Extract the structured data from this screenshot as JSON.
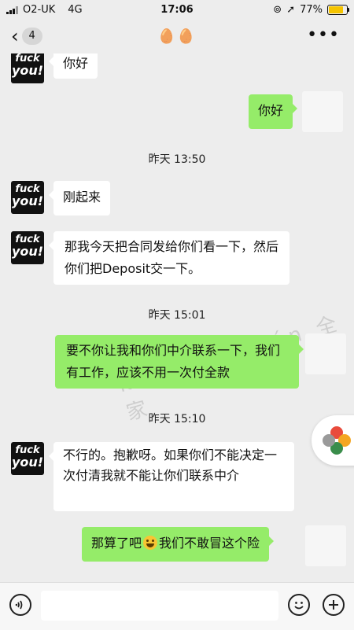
{
  "status_bar": {
    "carrier": "O2-UK",
    "network": "4G",
    "time": "17:06",
    "battery": "77%",
    "battery_level": 0.77
  },
  "nav": {
    "unread_count": "4",
    "title": "🥚🥚"
  },
  "messages": [
    {
      "side": "in",
      "text": "你好"
    },
    {
      "side": "out",
      "text": "你好"
    },
    {
      "type": "time",
      "text": "昨天 13:50"
    },
    {
      "side": "in",
      "text": "刚起来"
    },
    {
      "side": "in",
      "text": "那我今天把合同发给你们看一下，然后你们把Deposit交一下。"
    },
    {
      "type": "time",
      "text": "昨天 15:01"
    },
    {
      "side": "out",
      "text": "要不你让我和你们中介联系一下，我们有工作，应该不用一次付全款"
    },
    {
      "type": "time",
      "text": "昨天 15:10"
    },
    {
      "side": "in",
      "text": "不行的。抱歉呀。如果你们不能决定一次付清我就不能让你们联系中介"
    },
    {
      "side": "out",
      "text_before": "那算了吧",
      "text_after": "我们不敢冒这个险"
    }
  ],
  "avatar_text": {
    "line1": "fuck",
    "line2": "you!"
  },
  "watermark": "kàn 看能 quán 全 家",
  "icons": [
    "back-chevron-icon",
    "more-icon",
    "voice-icon",
    "emoji-face-icon",
    "plus-icon",
    "floating-petal-icon",
    "smile-emoji-icon"
  ],
  "colors": {
    "outgoing_bubble": "#95ec69",
    "incoming_bubble": "#ffffff",
    "background": "#ededed",
    "battery": "#f5c400"
  }
}
